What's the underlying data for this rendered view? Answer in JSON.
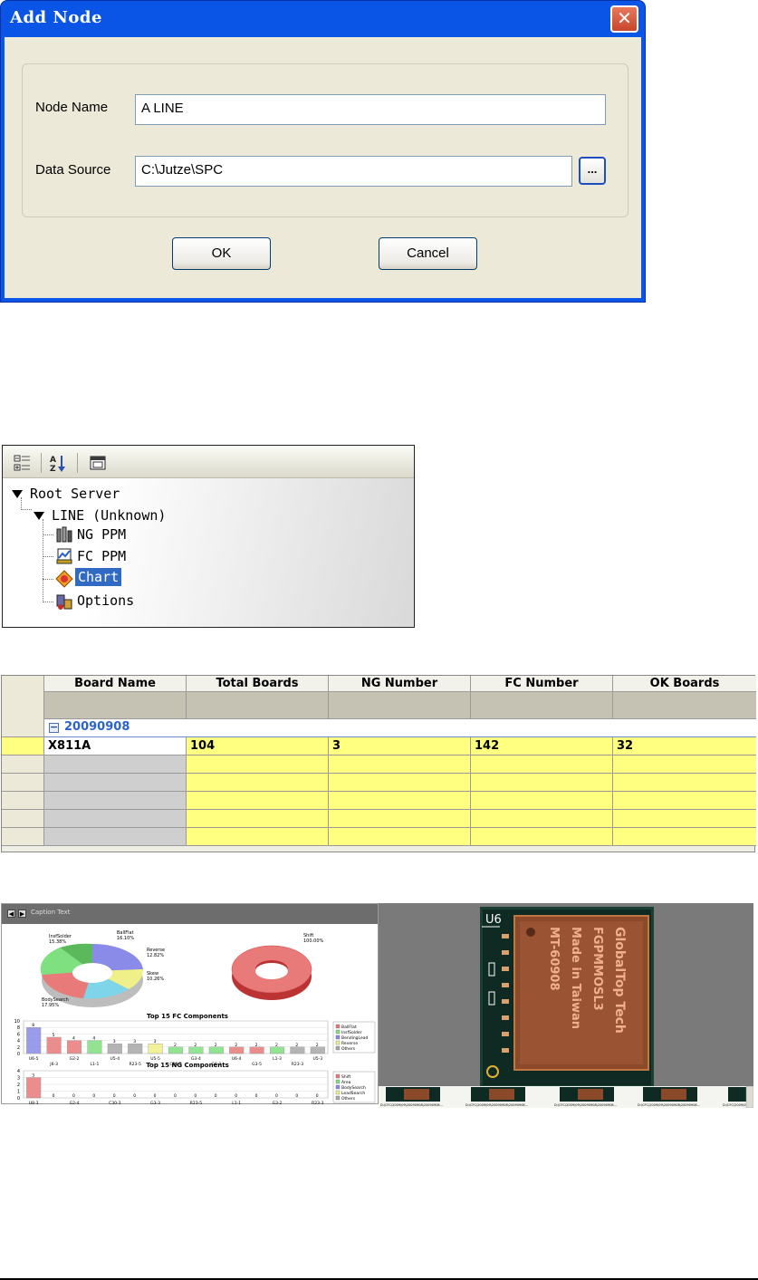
{
  "dialog": {
    "title": "Add Node",
    "close_glyph": "✕",
    "node_name_label": "Node Name",
    "node_name_value": "A LINE",
    "data_source_label": "Data Source",
    "data_source_value": "C:\\Jutze\\SPC",
    "browse_label": "...",
    "ok_label": "OK",
    "cancel_label": "Cancel"
  },
  "tree": {
    "toolbar_icons": [
      "categorized-icon",
      "sort-alphabetical-icon",
      "property-pages-icon"
    ],
    "root_label": "Root Server",
    "line_label": "LINE (Unknown)",
    "children": [
      {
        "label": "NG PPM",
        "icon": "ng-ppm-icon"
      },
      {
        "label": "FC PPM",
        "icon": "fc-ppm-icon"
      },
      {
        "label": "Chart",
        "icon": "chart-icon",
        "selected": true
      },
      {
        "label": "Options",
        "icon": "options-icon"
      }
    ]
  },
  "grid": {
    "columns": [
      "Board Name",
      "Total Boards",
      "NG Number",
      "FC Number",
      "OK Boards"
    ],
    "group_label": "20090908",
    "group_toggle": "−",
    "rows": [
      [
        "X811A",
        "104",
        "3",
        "142",
        "32"
      ]
    ],
    "empty_rows": 5
  },
  "chart_panel": {
    "top_label": "Caption Text",
    "pie_labels": [
      "BallFlat",
      "InsfSolder",
      "Reverse",
      "Skew",
      "BodySearch",
      "Shift"
    ],
    "pie_pcts": [
      "16.10%",
      "15.38%",
      "12.82%",
      "10.26%",
      "17.95%",
      "100.00%"
    ],
    "fc_title": "Top 15 FC Components",
    "ng_title": "Top 15 NG Components",
    "fc_legend": [
      "BallFlat",
      "InsfSolder",
      "BendingLead",
      "Reverse",
      "Others"
    ],
    "ng_legend": [
      "Shift",
      "Area",
      "BodySearch",
      "LeadSearch",
      "Others"
    ],
    "colors": {
      "red": "#e87a7a",
      "green": "#7fe07f",
      "blue": "#8a8ae8",
      "yellow": "#f0f08a",
      "grey": "#a8a8a8",
      "cyan": "#7ed4e8"
    }
  },
  "chart_data": [
    {
      "type": "bar",
      "title": "Top 15 FC Components",
      "ylim": [
        0,
        10
      ],
      "yticks": [
        "10",
        "8",
        "6",
        "4",
        "2",
        "0"
      ],
      "categories": [
        "U6-5",
        "J6-3",
        "G2-2",
        "L1-1",
        "U5-4",
        "R23-5",
        "U5-5",
        "C30-3",
        "G3-4",
        "G0-3",
        "U6-4",
        "G3-5",
        "L1-3",
        "R23-3",
        "U5-3"
      ],
      "values": [
        8,
        5,
        4,
        4,
        3,
        3,
        3,
        2,
        2,
        2,
        2,
        2,
        2,
        2,
        2
      ]
    },
    {
      "type": "bar",
      "title": "Top 15 NG Components",
      "ylim": [
        0,
        4
      ],
      "yticks": [
        "4",
        "3",
        "2",
        "1",
        "0"
      ],
      "categories": [
        "U8-3",
        "J6-4",
        "G2-4",
        "U6-1",
        "C30-3",
        "L1-5",
        "G3-3",
        "U6-3",
        "R23-5",
        "G3-5",
        "L1-1",
        "U6-5",
        "G3-2",
        "U5-5",
        "R23-3"
      ],
      "values": [
        3,
        0,
        0,
        0,
        0,
        0,
        0,
        0,
        0,
        0,
        0,
        0,
        0,
        0,
        0
      ]
    }
  ],
  "photo_panel": {
    "ref_label": "U6",
    "chip_lines": [
      "GlobalTop Tech",
      "FGPMMOSL3",
      "Made in Taiwan",
      "MT-60908"
    ],
    "thumb_caption": "D:\\CFC\\2009\\09\\20090908\\20090908..."
  }
}
